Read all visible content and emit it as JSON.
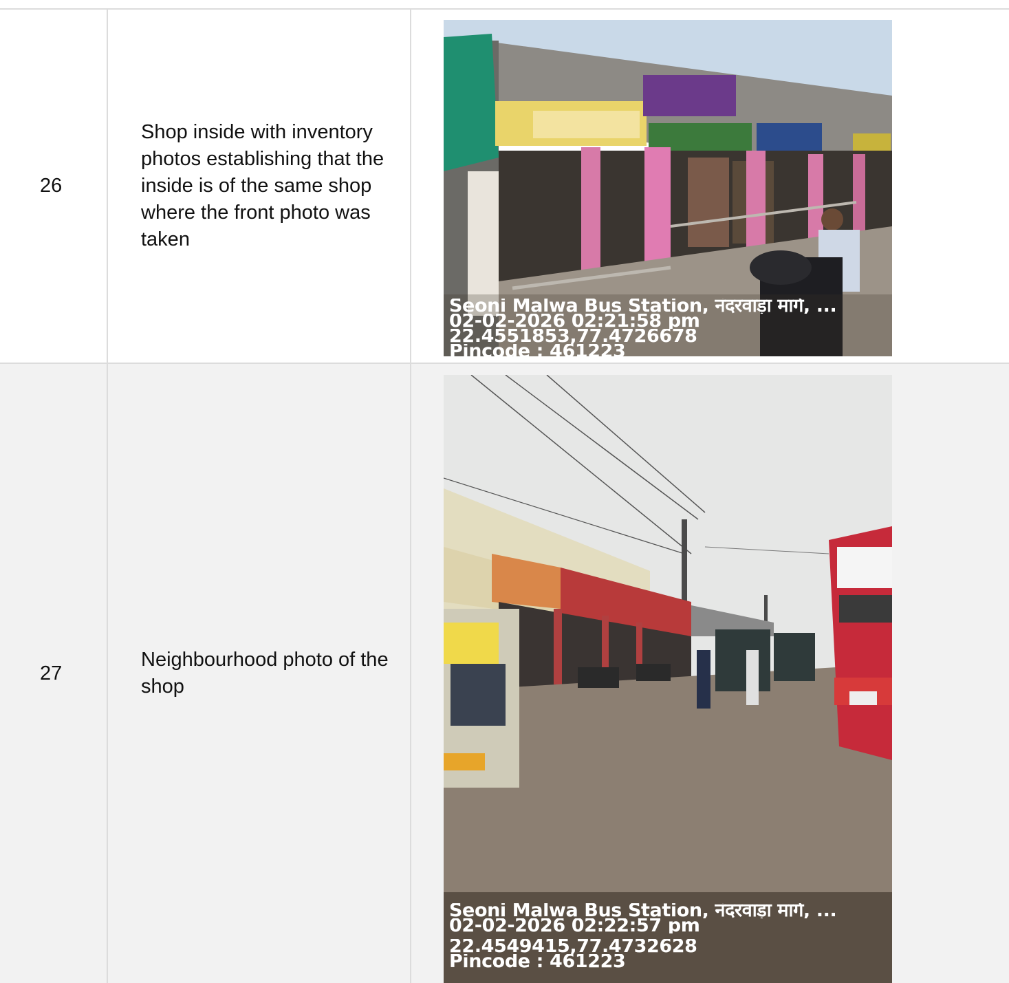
{
  "rows": [
    {
      "number": "26",
      "description": "Shop inside with inventory photos establishing that the inside is of the same shop where the front photo was taken",
      "photo": {
        "location": "Seoni Malwa Bus Station, नंदरवाड़ा मार्ग, ...",
        "datetime": "02-02-2026 02:21:58 pm",
        "coordinates": "22.4551853,77.4726678",
        "pincode": "Pincode : 461223"
      }
    },
    {
      "number": "27",
      "description": "Neighbourhood photo of the shop",
      "photo": {
        "location": "Seoni Malwa Bus Station, नंदरवाड़ा मार्ग, ...",
        "datetime": "02-02-2026 02:22:57 pm",
        "coordinates": "22.4549415,77.4732628",
        "pincode": "Pincode : 461223"
      }
    }
  ],
  "colors": {
    "border": "#dcdcdc",
    "alt_row": "#f2f2f2",
    "text": "#111111"
  }
}
